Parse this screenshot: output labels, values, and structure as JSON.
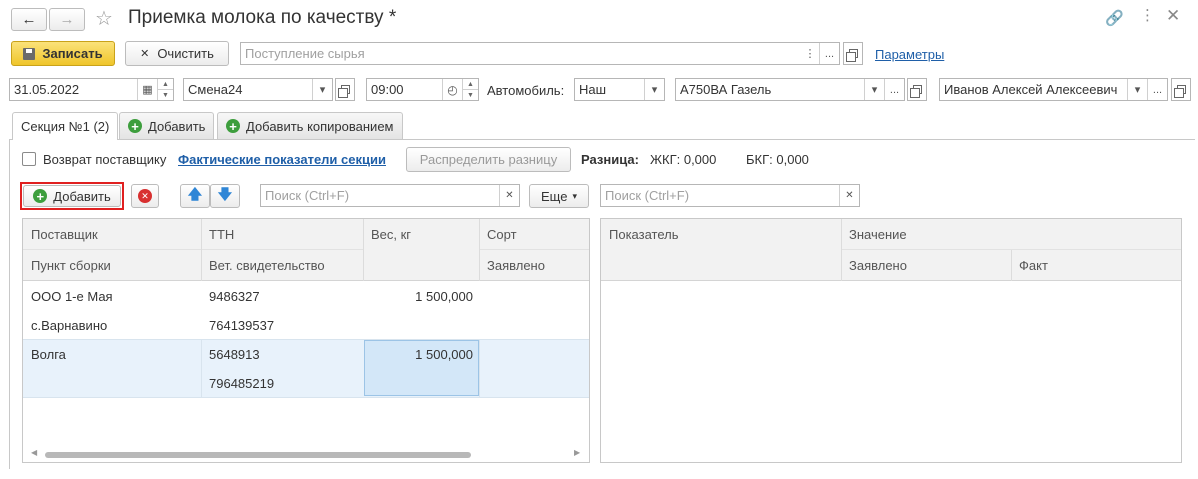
{
  "window": {
    "title": "Приемка молока по качеству *"
  },
  "toolbar": {
    "save_label": "Записать",
    "clear_label": "Очистить",
    "basis_placeholder": "Поступление сырья",
    "params_link": "Параметры"
  },
  "filters": {
    "date": "31.05.2022",
    "shift": "Смена24",
    "time": "09:00",
    "car_label": "Автомобиль:",
    "car_owner": "Наш",
    "car": "А750ВА Газель",
    "driver": "Иванов Алексей Алексеевич"
  },
  "tabs": [
    {
      "label": "Секция №1 (2)"
    },
    {
      "label": "Добавить"
    },
    {
      "label": "Добавить копированием"
    }
  ],
  "section": {
    "return_label": "Возврат поставщику",
    "actual_link": "Фактические показатели секции",
    "distribute_label": "Распределить разницу",
    "diff_label": "Разница:",
    "zhkg_label": "ЖКГ: 0,000",
    "bkg_label": "БКГ: 0,000"
  },
  "left_grid": {
    "add_label": "Добавить",
    "search_placeholder": "Поиск (Ctrl+F)",
    "more_label": "Еще",
    "headers": {
      "supplier": "Поставщик",
      "ttn": "ТТН",
      "weight": "Вес, кг",
      "sort": "Сорт",
      "point": "Пункт сборки",
      "vet": "Вет. свидетельство",
      "declared": "Заявлено"
    },
    "rows": [
      {
        "supplier": "ООО 1-е Мая",
        "ttn": "9486327",
        "weight": "1 500,000",
        "point": "с.Варнавино",
        "vet": "764139537"
      },
      {
        "supplier": "Волга",
        "ttn": "5648913",
        "weight": "1 500,000",
        "point": "",
        "vet": "796485219"
      }
    ]
  },
  "right_grid": {
    "search_placeholder": "Поиск (Ctrl+F)",
    "headers": {
      "indicator": "Показатель",
      "value": "Значение",
      "declared": "Заявлено",
      "fact": "Факт"
    }
  },
  "colors": {
    "save_button": "#f5d23c",
    "link": "#1f5fa8",
    "highlight_row": "#e8f2fb",
    "selected_cell": "#d3e7f8",
    "red_frame": "#e02020"
  }
}
